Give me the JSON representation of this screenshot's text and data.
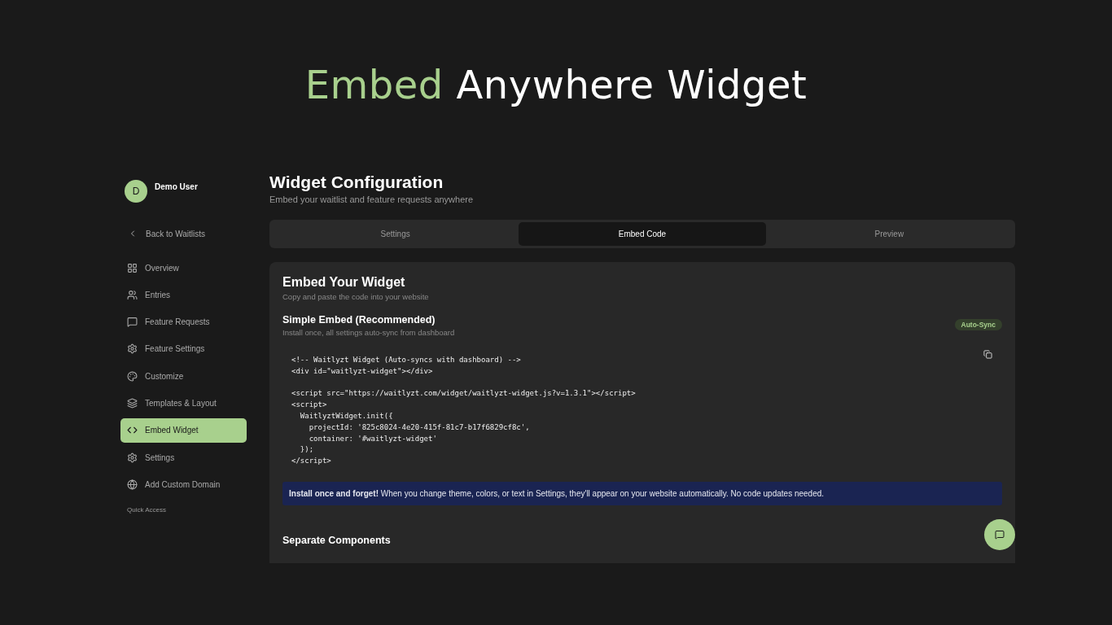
{
  "headline": {
    "accent": "Embed",
    "rest": "Anywhere Widget"
  },
  "user": {
    "initial": "D",
    "name": "Demo User"
  },
  "back_link": "Back to Waitlists",
  "sidebar": {
    "items": [
      {
        "label": "Overview",
        "selected": false
      },
      {
        "label": "Entries",
        "selected": false
      },
      {
        "label": "Feature Requests",
        "selected": false
      },
      {
        "label": "Feature Settings",
        "selected": false
      },
      {
        "label": "Customize",
        "selected": false
      },
      {
        "label": "Templates & Layout",
        "selected": false
      },
      {
        "label": "Embed Widget",
        "selected": true
      },
      {
        "label": "Settings",
        "selected": false
      },
      {
        "label": "Add Custom Domain",
        "selected": false
      }
    ],
    "section_label": "Quick Access"
  },
  "page": {
    "title": "Widget Configuration",
    "subtitle": "Embed your waitlist and feature requests anywhere"
  },
  "tabs": [
    {
      "label": "Settings",
      "selected": false
    },
    {
      "label": "Embed Code",
      "selected": true
    },
    {
      "label": "Preview",
      "selected": false
    }
  ],
  "card": {
    "title": "Embed Your Widget",
    "subtitle": "Copy and paste the code into your website",
    "section": {
      "title": "Simple Embed (Recommended)",
      "subtitle": "Install once, all settings auto-sync from dashboard",
      "badge": "Auto-Sync"
    },
    "code_blocks": [
      [
        "<!-- Waitlyzt Widget (Auto-syncs with dashboard) -->",
        "<div id=\"waitlyzt-widget\"></div>"
      ],
      [
        "<script src=\"https://waitlyzt.com/widget/waitlyzt-widget.js?v=1.3.1\"></script>",
        "<script>",
        "  WaitlyztWidget.init({",
        "    projectId: '825c8024-4e20-415f-81c7-b17f6829cf8c',",
        "    container: '#waitlyzt-widget'",
        "  });",
        "</script>"
      ]
    ],
    "notice": "**Install once and forget!** When you change theme, colors, or text in Settings, they'll appear on your website automatically. No code updates needed.",
    "next_section_title": "Separate Components"
  }
}
